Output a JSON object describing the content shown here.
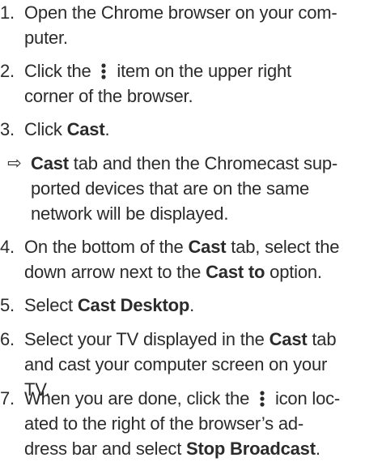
{
  "steps": [
    {
      "num": "1.",
      "lines": [
        "Open the Chrome browser on your com-",
        "puter."
      ]
    },
    {
      "num": "2.",
      "l1_before": "Click the ",
      "l1_after": " item on the upper right",
      "l2": "corner of the browser."
    },
    {
      "num": "3.",
      "before": "Click ",
      "bold": "Cast",
      "after": "."
    },
    {
      "arrow": "⇨",
      "l1_bold": "Cast",
      "l1_after": " tab and then the Chromecast sup-",
      "l2": "ported devices that are on the same",
      "l3": "network will be displayed."
    },
    {
      "num": "4.",
      "l1_before": "On the bottom of the ",
      "l1_bold": "Cast",
      "l1_after": " tab, select the",
      "l2_before": "down arrow next to the ",
      "l2_bold": "Cast to",
      "l2_after": " option."
    },
    {
      "num": "5.",
      "before": "Select ",
      "bold": "Cast Desktop",
      "after": "."
    },
    {
      "num": "6.",
      "l1_before": "Select your TV displayed in the ",
      "l1_bold": "Cast",
      "l1_after": " tab",
      "l2": "and cast your computer screen on your",
      "l3": "TV."
    },
    {
      "num": "7.",
      "l1_before": "When you are done, click the ",
      "l1_after": " icon loc-",
      "l2": "ated to the right of the browser’s ad-",
      "l3_before": "dress bar and select ",
      "l3_bold": "Stop Broadcast",
      "l3_after": "."
    }
  ],
  "icons": {
    "menu": "more-vertical-icon"
  }
}
